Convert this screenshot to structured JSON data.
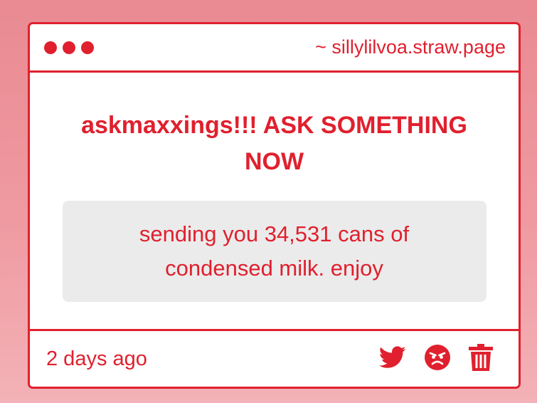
{
  "window": {
    "url": "~ sillylilvoa.straw.page"
  },
  "question": {
    "prompt": "askmaxxings!!! ASK SOMETHING NOW",
    "message": "sending you 34,531 cans of condensed milk. enjoy"
  },
  "footer": {
    "timestamp": "2 days ago",
    "actions": [
      {
        "icon": "twitter-icon"
      },
      {
        "icon": "angry-face-icon"
      },
      {
        "icon": "trash-icon"
      }
    ]
  },
  "colors": {
    "accent": "#e0202e",
    "message_bg": "#ebebeb",
    "background_top": "#ea8a92",
    "background_bottom": "#f3b2b7"
  }
}
